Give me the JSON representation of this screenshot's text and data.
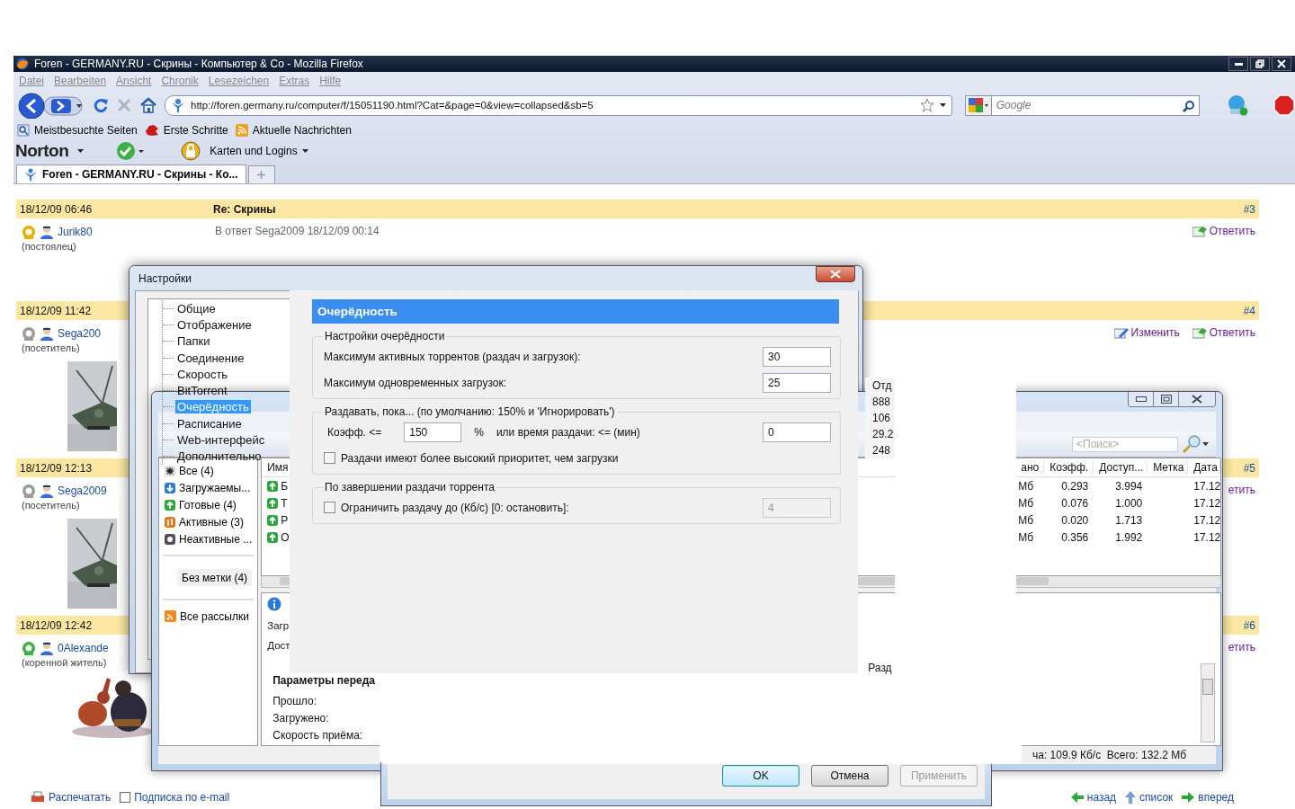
{
  "browser": {
    "title": "Foren - GERMANY.RU - Скрины - Компьютер & Co - Mozilla Firefox",
    "menu": [
      "Datei",
      "Bearbeiten",
      "Ansicht",
      "Chronik",
      "Lesezeichen",
      "Extras",
      "Hilfe"
    ],
    "url": "http://foren.germany.ru/computer/f/15051190.html?Cat=&page=0&view=collapsed&sb=5",
    "search_placeholder": "Google",
    "bookmarks": [
      {
        "label": "Meistbesuchte Seiten",
        "kind": "search"
      },
      {
        "label": "Erste Schritte",
        "kind": "fox"
      },
      {
        "label": "Aktuelle Nachrichten",
        "kind": "rss"
      }
    ],
    "norton": "Norton",
    "logins": "Karten und Logins",
    "tabs": [
      {
        "label": "Foren - GERMANY.RU - Скрины - Ко...",
        "selected": true
      }
    ]
  },
  "posts": [
    {
      "date": "18/12/09 06:46",
      "title": "Re: Скрины",
      "number": "#3",
      "user": "Jurik80",
      "rank": "(постоялец)",
      "color": "#e8b000",
      "reply_to": "В ответ Sega2009 18/12/09 00:14",
      "actions": [
        {
          "label": "Ответить",
          "kind": "reply"
        }
      ]
    },
    {
      "date": "18/12/09 11:42",
      "number": "#4",
      "user": "Sega200",
      "rank": "(посетитель)",
      "color": "#9a9a9a",
      "avatar": {
        "kind": "picture"
      },
      "actions": [
        {
          "label": "Изменить",
          "kind": "edit"
        },
        {
          "label": "Ответить",
          "kind": "reply"
        }
      ]
    },
    {
      "date": "18/12/09 12:13",
      "number": "#5",
      "user": "Sega2009",
      "rank": "(посетитель)",
      "color": "#9a9a9a",
      "avatar": {
        "kind": "picture"
      },
      "actions": [
        {
          "label": "етить",
          "kind": "text"
        }
      ]
    },
    {
      "date": "18/12/09 12:42",
      "number": "#6",
      "user": "0Alexande",
      "rank": "(коренной житель)",
      "color": "#3cb043",
      "avatar": {
        "kind": "picture"
      },
      "actions": [
        {
          "label": "етить",
          "kind": "text"
        }
      ]
    }
  ],
  "footer": {
    "left": [
      {
        "label": "Распечатать",
        "kind": "print"
      },
      {
        "label": "Подписка по e-mail",
        "kind": "mail"
      }
    ],
    "right": [
      {
        "label": "назад",
        "kind": "back"
      },
      {
        "label": "список",
        "kind": "up"
      },
      {
        "label": "вперед",
        "kind": "forward"
      }
    ]
  },
  "list_fragment": {
    "header": "Отд",
    "values": [
      "888",
      "106",
      "29.2",
      "248"
    ]
  },
  "torrent": {
    "search_placeholder": "<Поиск>",
    "categories": [
      {
        "label": "Все (4)",
        "kind": "all",
        "selected": false
      },
      {
        "label": "Загружаемы...",
        "kind": "down",
        "selected": false
      },
      {
        "label": "Готовые (4)",
        "kind": "done",
        "selected": false
      },
      {
        "label": "Активные (3)",
        "kind": "active",
        "selected": false
      },
      {
        "label": "Неактивные ...",
        "kind": "inactive",
        "selected": false
      },
      {
        "label": "Без метки (4)",
        "kind": "label",
        "selected": true
      },
      {
        "label": "Все рассылки",
        "kind": "rss",
        "selected": false
      }
    ],
    "columns": [
      "Имя",
      "ано",
      "Коэфф.",
      "Доступ...",
      "Метка",
      "Дата"
    ],
    "rows": [
      {
        "name": "Б",
        "size": "Мб",
        "ratio": "0.293",
        "available": "3.994",
        "date": "17.12"
      },
      {
        "name": "Т",
        "size": "Мб",
        "ratio": "0.076",
        "available": "1.000",
        "date": "17.12"
      },
      {
        "name": "Р",
        "size": "Мб",
        "ratio": "0.020",
        "available": "1.713",
        "date": "17.12"
      },
      {
        "name": "О",
        "size": "Мб",
        "ratio": "0.356",
        "available": "1.992",
        "date": "17.12"
      }
    ],
    "details": {
      "lines": [
        "Загр",
        "Дост"
      ],
      "section": "Параметры переда",
      "fields": [
        "Прошло:",
        "Загружено:",
        "Скорость приёма:"
      ],
      "tab": "Разд"
    },
    "status": "ча: 109.9 Кб/с  Всего: 132.2 Мб"
  },
  "settings": {
    "title": "Настройки",
    "tree": [
      {
        "label": "Общие",
        "selected": false
      },
      {
        "label": "Отображение",
        "selected": false
      },
      {
        "label": "Папки",
        "selected": false
      },
      {
        "label": "Соединение",
        "selected": false
      },
      {
        "label": "Скорость",
        "selected": false
      },
      {
        "label": "BitTorrent",
        "selected": false
      },
      {
        "label": "Очерёдность",
        "selected": true
      },
      {
        "label": "Расписание",
        "selected": false
      },
      {
        "label": "Web-интерфейс",
        "selected": false
      },
      {
        "label": "Дополнительно",
        "selected": false
      }
    ],
    "page_title": "Очерёдность",
    "groups": [
      {
        "title": "Настройки очерёдности",
        "rows": [
          {
            "kind": "number",
            "label": "Максимум активных торрентов (раздач и загрузок):",
            "value": "30"
          },
          {
            "kind": "number",
            "label": "Максимум одновременных загрузок:",
            "value": "25"
          }
        ]
      },
      {
        "title": "Раздавать, пока... (по умолчанию: 150% и 'Игнорировать')",
        "rows": [
          {
            "kind": "ratio",
            "label": "Коэфф. <=",
            "value": "150",
            "unit": "%",
            "label2": "или время раздачи: <= (мин)",
            "value2": "0"
          },
          {
            "kind": "checkbox",
            "label": "Раздачи имеют более высокий приоритет, чем загрузки",
            "checked": false
          }
        ]
      },
      {
        "title": "По завершении раздачи торрента",
        "rows": [
          {
            "kind": "checkbox_number",
            "label": "Ограничить раздачу до (Кб/с) [0: остановить]:",
            "checked": false,
            "value": "4",
            "disabled": true
          }
        ]
      }
    ],
    "buttons": [
      {
        "label": "OK",
        "kind": "default",
        "disabled": false
      },
      {
        "label": "Отмена",
        "kind": "normal",
        "disabled": false
      },
      {
        "label": "Применить",
        "kind": "normal",
        "disabled": true
      }
    ]
  }
}
